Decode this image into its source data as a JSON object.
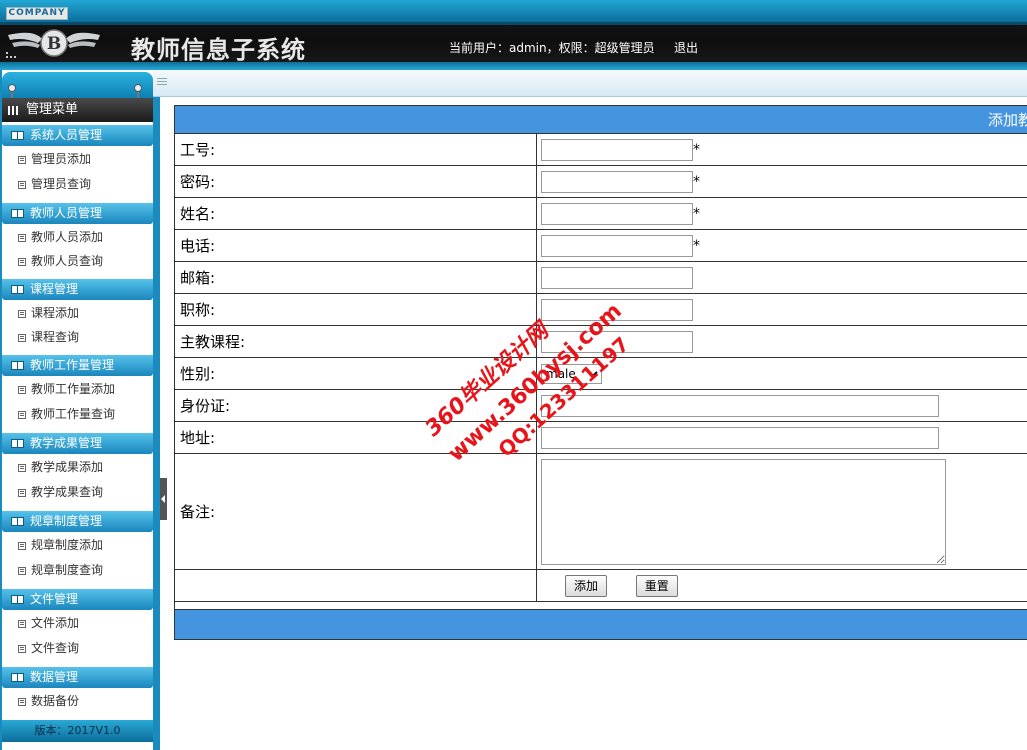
{
  "header": {
    "company_label": "COMPANY",
    "title": "教师信息子系统",
    "user_info": "当前用户：admin，权限：超级管理员",
    "logout_label": "退出"
  },
  "sidebar": {
    "menu_title": "管理菜单",
    "groups": [
      {
        "title": "系统人员管理",
        "items": [
          {
            "label": "管理员添加"
          },
          {
            "label": "管理员查询"
          }
        ]
      },
      {
        "title": "教师人员管理",
        "items": [
          {
            "label": "教师人员添加"
          },
          {
            "label": "教师人员查询"
          }
        ]
      },
      {
        "title": "课程管理",
        "items": [
          {
            "label": "课程添加"
          },
          {
            "label": "课程查询"
          }
        ]
      },
      {
        "title": "教师工作量管理",
        "items": [
          {
            "label": "教师工作量添加"
          },
          {
            "label": "教师工作量查询"
          }
        ]
      },
      {
        "title": "教学成果管理",
        "items": [
          {
            "label": "教学成果添加"
          },
          {
            "label": "教学成果查询"
          }
        ]
      },
      {
        "title": "规章制度管理",
        "items": [
          {
            "label": "规章制度添加"
          },
          {
            "label": "规章制度查询"
          }
        ]
      },
      {
        "title": "文件管理",
        "items": [
          {
            "label": "文件添加"
          },
          {
            "label": "文件查询"
          }
        ]
      },
      {
        "title": "数据管理",
        "items": [
          {
            "label": "数据备份"
          }
        ]
      }
    ],
    "version": "版本：2017V1.0"
  },
  "form": {
    "header_title": "添加教",
    "fields": [
      {
        "label": "工号:",
        "value": "",
        "required_mark": "*"
      },
      {
        "label": "密码:",
        "value": "",
        "required_mark": "*"
      },
      {
        "label": "姓名:",
        "value": "",
        "required_mark": "*"
      },
      {
        "label": "电话:",
        "value": "",
        "required_mark": "*"
      },
      {
        "label": "邮箱:",
        "value": ""
      },
      {
        "label": "职称:",
        "value": ""
      },
      {
        "label": "主教课程:",
        "value": ""
      },
      {
        "label": "性别:",
        "value": "male"
      },
      {
        "label": "身份证:",
        "value": ""
      },
      {
        "label": "地址:",
        "value": ""
      },
      {
        "label": "备注:",
        "value": ""
      }
    ],
    "submit_label": "添加",
    "reset_label": "重置"
  },
  "watermark": {
    "line1": "360毕业设计网",
    "line2": "www.360bysj.com",
    "line3": "QQ:123311197",
    "color": "#e8141a"
  },
  "colors": {
    "accent": "#1a8bbf",
    "form_header": "#4594e0"
  }
}
